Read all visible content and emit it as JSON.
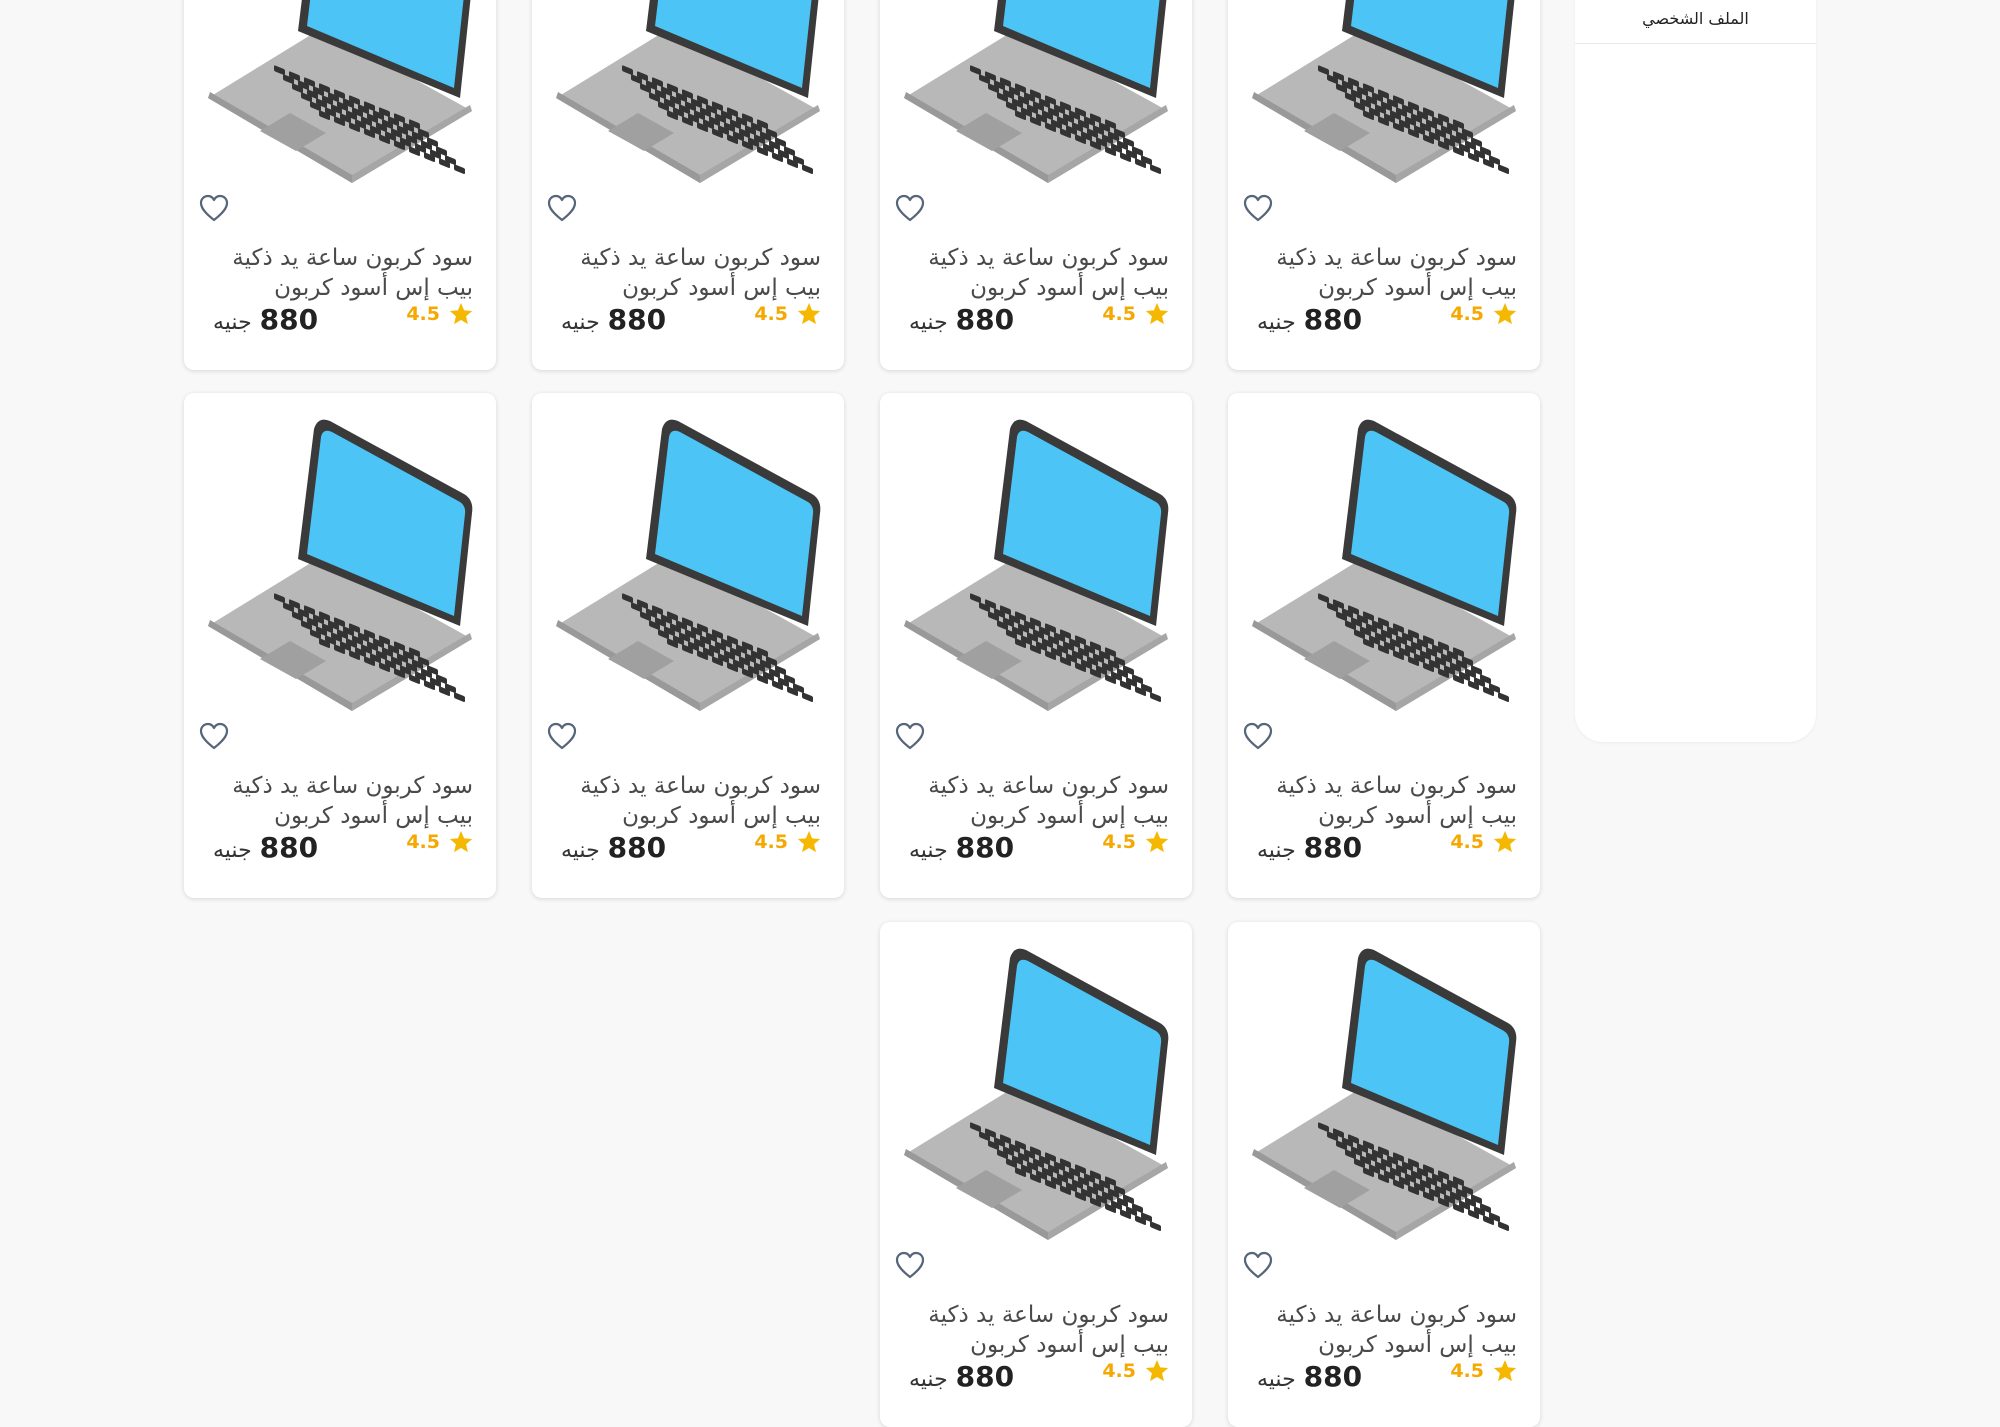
{
  "sidebar": {
    "items": [
      {
        "label": "الملف الشخصي"
      }
    ]
  },
  "colors": {
    "background": "#f8f8f8",
    "star": "#f5b800",
    "heart_outline": "#56657a",
    "screen": "#4cc4f5"
  },
  "products": [
    {
      "title": "سود كربون ساعة يد ذكية بيب إس أسود كربون",
      "price": "880",
      "currency": "جنيه",
      "rating": "4.5"
    },
    {
      "title": "سود كربون ساعة يد ذكية بيب إس أسود كربون",
      "price": "880",
      "currency": "جنيه",
      "rating": "4.5"
    },
    {
      "title": "سود كربون ساعة يد ذكية بيب إس أسود كربون",
      "price": "880",
      "currency": "جنيه",
      "rating": "4.5"
    },
    {
      "title": "سود كربون ساعة يد ذكية بيب إس أسود كربون",
      "price": "880",
      "currency": "جنيه",
      "rating": "4.5"
    },
    {
      "title": "سود كربون ساعة يد ذكية بيب إس أسود كربون",
      "price": "880",
      "currency": "جنيه",
      "rating": "4.5"
    },
    {
      "title": "سود كربون ساعة يد ذكية بيب إس أسود كربون",
      "price": "880",
      "currency": "جنيه",
      "rating": "4.5"
    },
    {
      "title": "سود كربون ساعة يد ذكية بيب إس أسود كربون",
      "price": "880",
      "currency": "جنيه",
      "rating": "4.5"
    },
    {
      "title": "سود كربون ساعة يد ذكية بيب إس أسود كربون",
      "price": "880",
      "currency": "جنيه",
      "rating": "4.5"
    },
    {
      "title": "سود كربون ساعة يد ذكية بيب إس أسود كربون",
      "price": "880",
      "currency": "جنيه",
      "rating": "4.5"
    },
    {
      "title": "سود كربون ساعة يد ذكية بيب إس أسود كربون",
      "price": "880",
      "currency": "جنيه",
      "rating": "4.5"
    }
  ]
}
